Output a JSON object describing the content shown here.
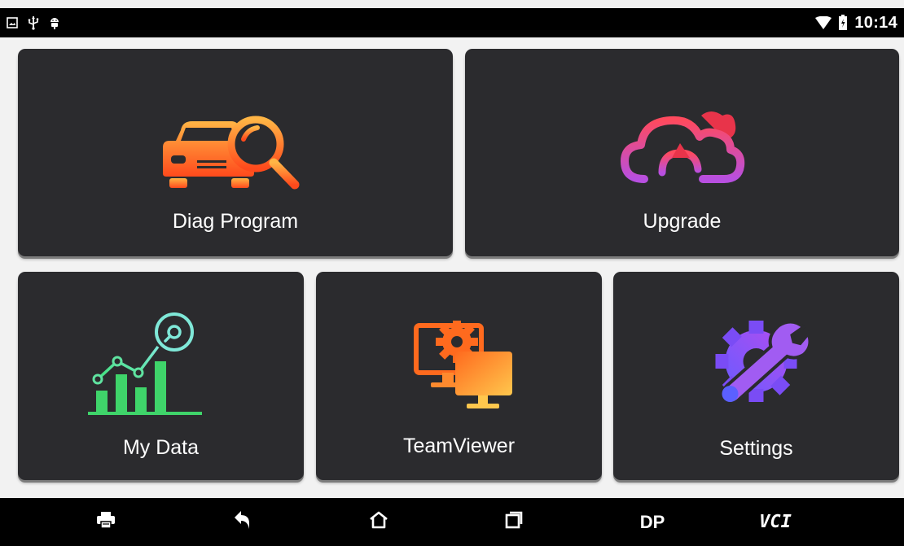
{
  "status_bar": {
    "time": "10:14",
    "left_icons": [
      "image-icon",
      "usb-icon",
      "android-debug-icon"
    ],
    "right_icons": [
      "wifi-icon",
      "battery-icon"
    ]
  },
  "tiles": [
    {
      "id": "diag_program",
      "label": "Diag Program",
      "icon": "car-search-icon"
    },
    {
      "id": "upgrade",
      "label": "Upgrade",
      "icon": "cloud-upload-icon"
    },
    {
      "id": "my_data",
      "label": "My Data",
      "icon": "data-chart-icon"
    },
    {
      "id": "teamviewer",
      "label": "TeamViewer",
      "icon": "remote-monitors-icon"
    },
    {
      "id": "settings",
      "label": "Settings",
      "icon": "gear-wrench-icon"
    }
  ],
  "nav_bar": {
    "items": [
      {
        "icon": "printer-icon"
      },
      {
        "icon": "back-icon"
      },
      {
        "icon": "home-icon"
      },
      {
        "icon": "recent-apps-icon"
      },
      {
        "label": "DP"
      },
      {
        "label": "VCI"
      }
    ]
  },
  "colors": {
    "tile_bg": "#2b2b2e",
    "status_bar": "#000000",
    "nav_bar": "#000000",
    "diag_gradient": [
      "#ffb545",
      "#ff4a1c"
    ],
    "upgrade_gradient": [
      "#ff4a5e",
      "#b84fe0"
    ],
    "mydata_gradient": [
      "#3fe07a",
      "#7fe8d8"
    ],
    "teamviewer_gradient": [
      "#ff6a1e",
      "#ffc74d"
    ],
    "settings_gradient": [
      "#6a5bff",
      "#b04df0"
    ]
  }
}
